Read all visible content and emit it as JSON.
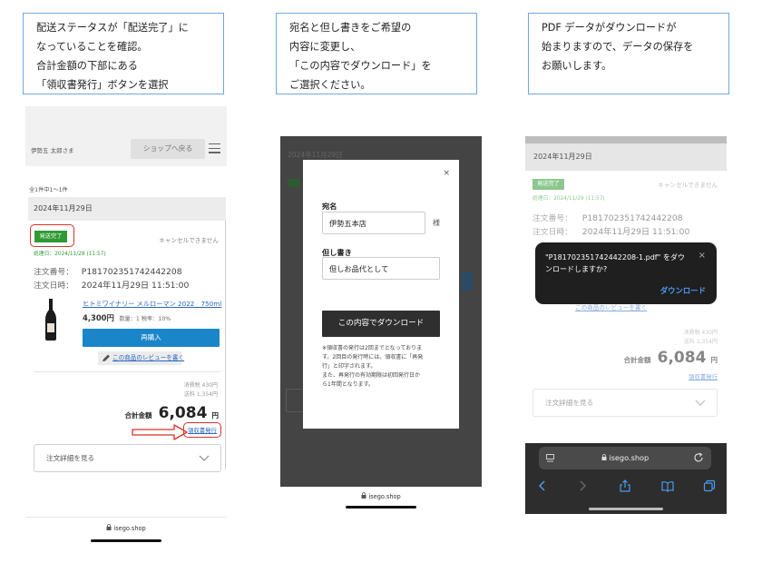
{
  "instructions": [
    [
      "配送ステータスが「配送完了」に",
      "なっていることを確認。",
      "合計金額の下部にある",
      "「領収書発行」ボタンを選択"
    ],
    [
      "宛名と但し書きをご希望の",
      "内容に変更し、",
      "「この内容でダウンロード」を",
      "ご選択ください。"
    ],
    [
      "PDF データがダウンロードが",
      "始まりますので、データの保存を",
      "お願いします。"
    ]
  ],
  "phone1": {
    "user_name": "伊勢五 太郎さま",
    "shop_back_button": "ショップへ戻る",
    "order_count": "全1件中1〜1件",
    "order_date": "2024年11月29日",
    "status_badge": "発送完了",
    "cancel_note": "キャンセルできません",
    "processed_date": "処理日：2024/11/29 (11:57)",
    "order_no_label": "注文番号：",
    "order_no_value": "P181702351742442208",
    "order_datetime_label": "注文日時：",
    "order_datetime_value": "2024年11月29日 11:51:00",
    "product_name": "ヒトミワイナリー メルローマン 2022　750ml",
    "product_price": "4,300円",
    "product_qty": "数量：1 税率：10%",
    "rebuy_button": "再購入",
    "review_link": "この商品のレビューを書く",
    "tax_line": "消費税 430円",
    "shipping_line": "送料 1,354円",
    "total_label": "合計金額",
    "total_amount": "6,084",
    "total_yen": "円",
    "receipt_link": "領収書発行",
    "order_detail_button": "注文詳細を見る",
    "url": "isego.shop"
  },
  "phone2": {
    "bg_date": "2024年11月29日",
    "close_glyph": "×",
    "addressee_label": "宛名",
    "addressee_value": "伊勢五本店",
    "honorific": "様",
    "proviso_label": "但し書き",
    "proviso_value": "但しお品代として",
    "download_button": "この内容でダウンロード",
    "note_lines": [
      "※領収書の発行は2回までとなっておりま",
      "す。2回目の発行時には、領収書に「再発",
      "行」と印字されます。",
      "また、再発行の有効期限は初回発行日か",
      "ら1年間となります。"
    ],
    "url": "isego.shop"
  },
  "phone3": {
    "order_date": "2024年11月29日",
    "status_badge": "発送完了",
    "cancel_note": "キャンセルできません",
    "processed_date": "処理日：2024/11/29 (11:57)",
    "order_no_label": "注文番号：",
    "order_no_value": "P181702351742442208",
    "order_datetime_label": "注文日時：",
    "order_datetime_value": "2024年11月29日 11:51:00",
    "popup_text": "\"P181702351742442208-1.pdf\" をダウンロードしますか?",
    "popup_close": "×",
    "popup_download": "ダウンロード",
    "review_link": "この商品のレビューを書く",
    "tax_line": "消費税 430円",
    "shipping_line": "送料 1,354円",
    "total_label": "合計金額",
    "total_amount": "6,084",
    "total_yen": "円",
    "receipt_link": "領収書発行",
    "order_detail_button": "注文詳細を見る",
    "url": "isego.shop"
  },
  "colors": {
    "accent_blue": "#1a85c9",
    "status_green": "#2e9a34",
    "highlight_red": "#d8322a",
    "box_border": "#6fa8dc",
    "ios_link": "#4a9bf0"
  },
  "icons": [
    "menu-icon",
    "wine-bottle-icon",
    "pencil-icon",
    "chevron-down-icon",
    "lock-icon",
    "reload-icon",
    "back-icon",
    "forward-icon",
    "share-icon",
    "bookmarks-icon",
    "tabs-icon",
    "close-icon",
    "arrow-right-icon"
  ]
}
